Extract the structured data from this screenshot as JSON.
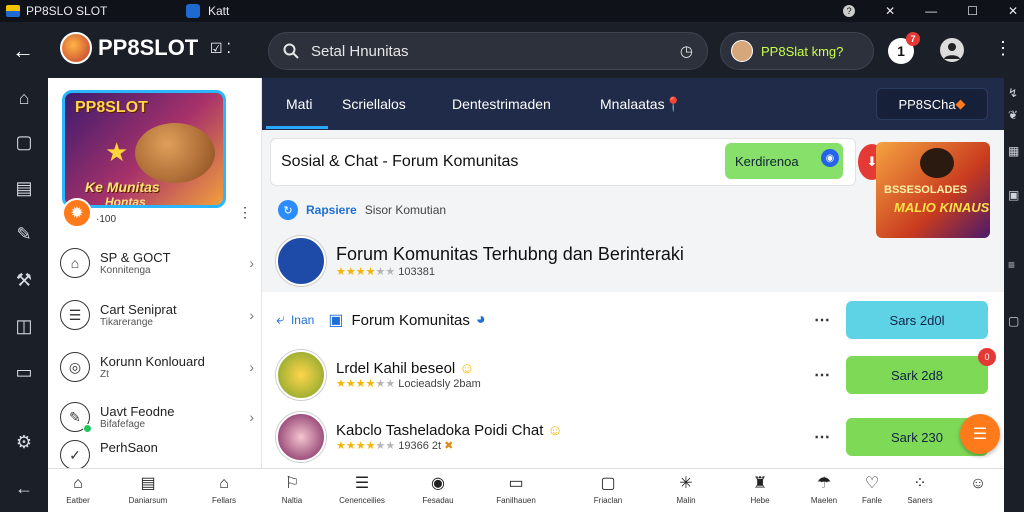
{
  "window": {
    "app_title": "PP8SLO SLOT",
    "second_tab": "Katt"
  },
  "topbar": {
    "brand": "PP8SLOT",
    "search_text": "Setal Hnunitas",
    "user_label": "PP8Slat kmg?",
    "notif_count": "1",
    "notif_badge": "7"
  },
  "sidebar": {
    "banner_title": "PP8SLOT",
    "banner_line1": "Ke Munitas",
    "banner_line2": "Hontas",
    "coin_count": "·100",
    "items": [
      {
        "title": "SP & GOCT",
        "sub": "Konnitenga"
      },
      {
        "title": "Cart Seniprat",
        "sub": "Tikarerange"
      },
      {
        "title": "Korunn Konlouard",
        "sub": "Zt"
      },
      {
        "title": "Uavt Feodne",
        "sub": "Bifafefage"
      },
      {
        "title": "PerhSaon",
        "sub": ""
      }
    ]
  },
  "tabs": {
    "items": [
      "Mati",
      "Scriellalos",
      "Dentestrimaden",
      "Mnalaatas"
    ],
    "right_pill": "PP8SCha"
  },
  "header_card": {
    "title": "Sosial & Chat  -  Forum Komunitas",
    "button": "Kerdirenoa"
  },
  "promo": {
    "line1": "BSSESOLADES",
    "line2": "MALIO KINAUS"
  },
  "register_row": {
    "label": "Rapsiere",
    "sub": "Sisor Komutian"
  },
  "forum": {
    "title": "Forum Komunitas Terhubng dan Berinteraki",
    "rating_text": "103381",
    "stars": 4
  },
  "list": [
    {
      "prefix": "Inan",
      "title": "Forum Komunitas",
      "sub": "",
      "button": "Sars 2d0l",
      "stars": 0
    },
    {
      "prefix": "",
      "title": "Lrdel Kahil beseol",
      "sub": "Locieadsly 2bam",
      "button": "Sark 2d8",
      "stars": 4
    },
    {
      "prefix": "",
      "title": "Kabclo Tasheladoka Poidi Chat",
      "sub": "19366 2t",
      "button": "Sark 230",
      "stars": 4
    }
  ],
  "bottom_nav": [
    {
      "icon": "home",
      "label": "Eatber"
    },
    {
      "icon": "doc",
      "label": "Daniarsum"
    },
    {
      "icon": "house",
      "label": "Fellars"
    },
    {
      "icon": "car",
      "label": "Naltia"
    },
    {
      "icon": "list",
      "label": "Cenenceilies"
    },
    {
      "icon": "pin",
      "label": "Fesadau"
    },
    {
      "icon": "folder",
      "label": "Fanilhauen"
    },
    {
      "icon": "chat",
      "label": "Friaclan"
    },
    {
      "icon": "bug",
      "label": "Malin"
    },
    {
      "icon": "bell",
      "label": "Hebe"
    },
    {
      "icon": "umbrella",
      "label": "Maelen"
    },
    {
      "icon": "heart",
      "label": "Fanle"
    },
    {
      "icon": "grid",
      "label": "Saners"
    },
    {
      "icon": "smile",
      "label": ""
    }
  ],
  "colors": {
    "accent": "#29a7ff",
    "green_button": "#7ed957",
    "cyan_button": "#5fd3e6",
    "dark_bg": "#1b1f27",
    "tab_bar": "#1f2b48"
  }
}
